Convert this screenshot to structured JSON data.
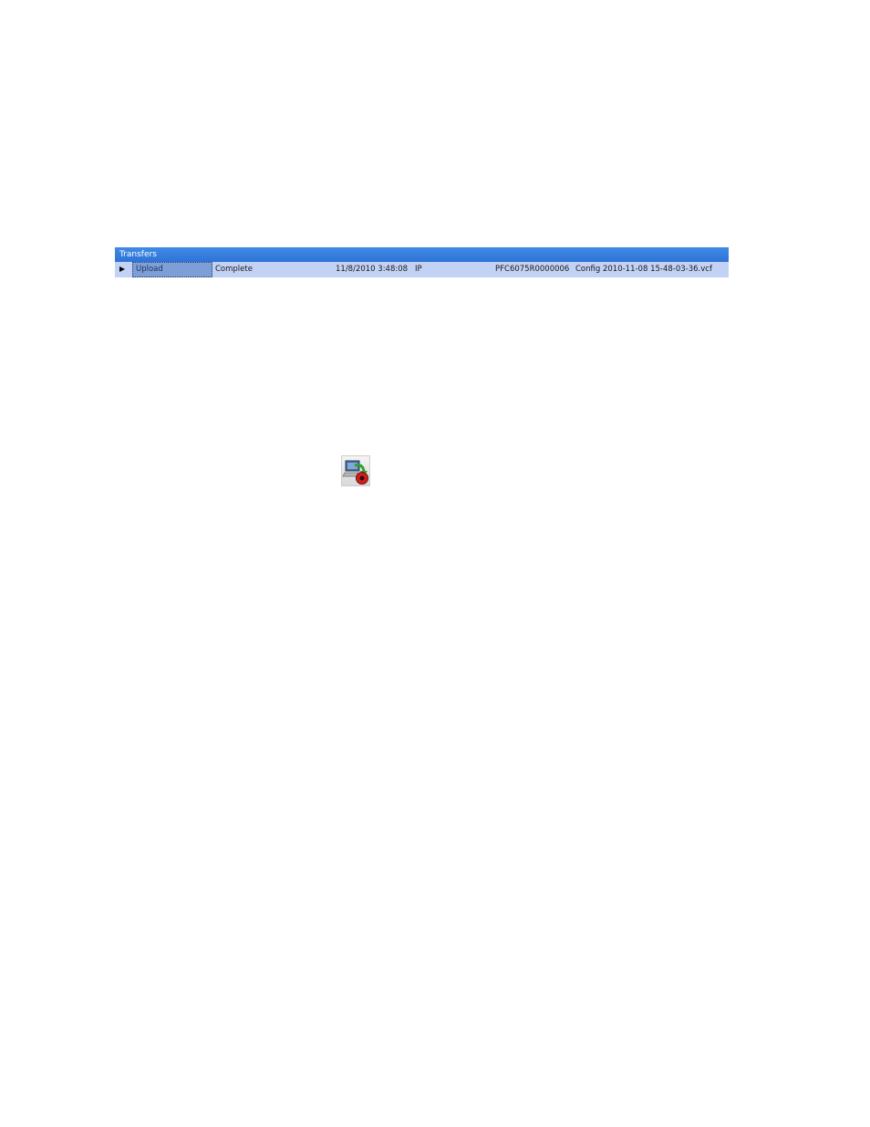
{
  "transfers": {
    "title": "Transfers",
    "rows": [
      {
        "type": "Upload",
        "status": "Complete",
        "datetime": "11/8/2010 3:48:08",
        "connection": "IP",
        "device": "PFC6075R0000006",
        "filename": "Config 2010-11-08 15-48-03-36.vcf"
      }
    ]
  },
  "icons": {
    "row_pointer": "row-pointer-triangle-icon",
    "toolbar_button": "upload-to-device-icon"
  },
  "colors": {
    "header_bg": "#3080e0",
    "row_bg": "#c2d2f4",
    "selected_cell_bg": "#7d9fd8"
  }
}
